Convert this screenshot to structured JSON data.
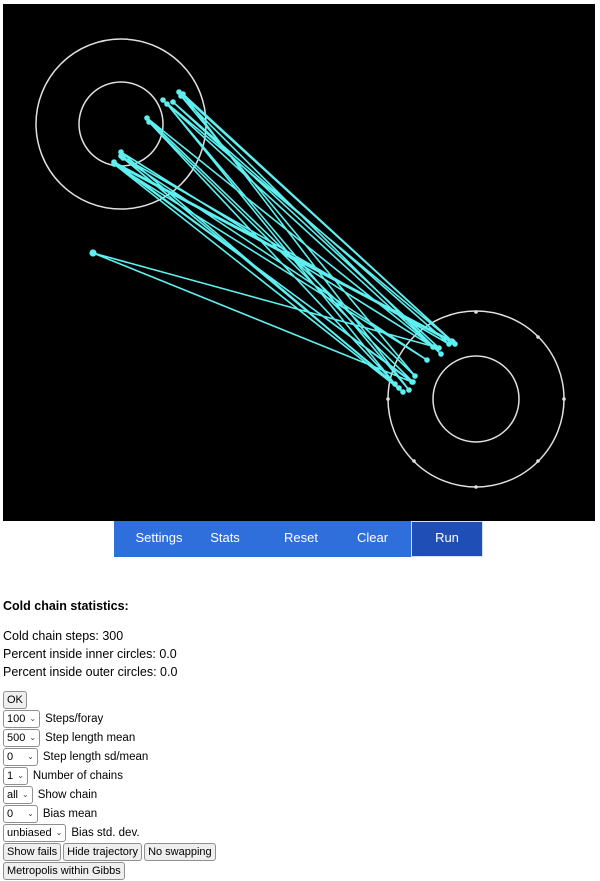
{
  "toolbar": {
    "items": [
      {
        "label": "Settings"
      },
      {
        "label": "Stats"
      },
      {
        "label": "Reset"
      },
      {
        "label": "Clear"
      },
      {
        "label": "Run"
      }
    ]
  },
  "stats": {
    "heading": "Cold chain statistics:",
    "lines": [
      "Cold chain steps: 300",
      "Percent inside inner circles: 0.0",
      "Percent inside outer circles: 0.0"
    ]
  },
  "controls": {
    "ok_label": "OK",
    "steps_foray": {
      "value": "100",
      "label": "Steps/foray"
    },
    "step_length_mean": {
      "value": "500",
      "label": "Step length mean"
    },
    "step_length_sd": {
      "value": "0",
      "label": "Step length sd/mean"
    },
    "num_chains": {
      "value": "1",
      "label": "Number of chains"
    },
    "show_chain": {
      "value": "all",
      "label": "Show chain"
    },
    "bias_mean": {
      "value": "0",
      "label": "Bias mean"
    },
    "bias_sd": {
      "value": "unbiased",
      "label": "Bias std. dev."
    },
    "show_fails_label": "Show fails",
    "hide_trajectory_label": "Hide trajectory",
    "no_swapping_label": "No swapping",
    "metropolis_label": "Metropolis within Gibbs"
  },
  "colors": {
    "canvas_bg": "#000000",
    "trajectory": "#5ef0f0",
    "circle": "#e0e0e0",
    "toolbar_bg": "#2f6fdc",
    "toolbar_active": "#1f4fb6"
  }
}
